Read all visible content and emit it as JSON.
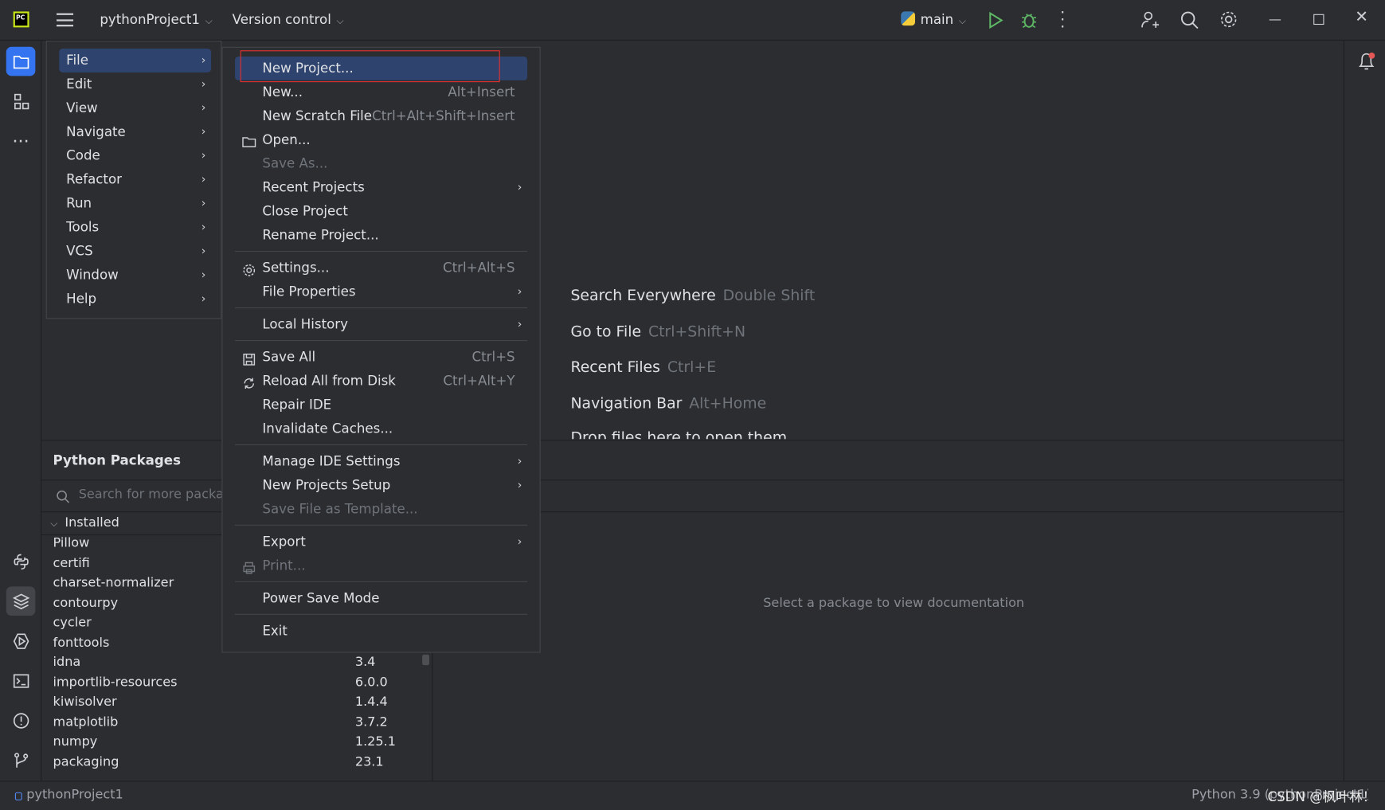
{
  "titlebar": {
    "project": "pythonProject1",
    "vcs": "Version control",
    "run_config": "main"
  },
  "main_menu": {
    "items": [
      {
        "label": "File",
        "selected": true
      },
      {
        "label": "Edit"
      },
      {
        "label": "View"
      },
      {
        "label": "Navigate"
      },
      {
        "label": "Code"
      },
      {
        "label": "Refactor"
      },
      {
        "label": "Run"
      },
      {
        "label": "Tools"
      },
      {
        "label": "VCS"
      },
      {
        "label": "Window"
      },
      {
        "label": "Help"
      }
    ]
  },
  "file_menu": {
    "items": [
      {
        "label": "New Project...",
        "selected": true
      },
      {
        "label": "New...",
        "shortcut": "Alt+Insert"
      },
      {
        "label": "New Scratch File",
        "shortcut": "Ctrl+Alt+Shift+Insert"
      },
      {
        "label": "Open...",
        "icon": "folder-icon"
      },
      {
        "label": "Save As...",
        "disabled": true
      },
      {
        "label": "Recent Projects",
        "submenu": true
      },
      {
        "label": "Close Project"
      },
      {
        "label": "Rename Project..."
      },
      {
        "separator": true
      },
      {
        "label": "Settings...",
        "shortcut": "Ctrl+Alt+S",
        "icon": "gear-icon"
      },
      {
        "label": "File Properties",
        "submenu": true
      },
      {
        "separator": true
      },
      {
        "label": "Local History",
        "submenu": true
      },
      {
        "separator": true
      },
      {
        "label": "Save All",
        "shortcut": "Ctrl+S",
        "icon": "save-icon"
      },
      {
        "label": "Reload All from Disk",
        "shortcut": "Ctrl+Alt+Y",
        "icon": "reload-icon"
      },
      {
        "label": "Repair IDE"
      },
      {
        "label": "Invalidate Caches..."
      },
      {
        "separator": true
      },
      {
        "label": "Manage IDE Settings",
        "submenu": true
      },
      {
        "label": "New Projects Setup",
        "submenu": true
      },
      {
        "label": "Save File as Template...",
        "disabled": true
      },
      {
        "separator": true
      },
      {
        "label": "Export",
        "submenu": true
      },
      {
        "label": "Print...",
        "disabled": true,
        "icon": "printer-icon"
      },
      {
        "separator": true
      },
      {
        "label": "Power Save Mode"
      },
      {
        "separator": true
      },
      {
        "label": "Exit"
      }
    ]
  },
  "editor_hints": [
    {
      "label": "Search Everywhere",
      "shortcut": "Double Shift"
    },
    {
      "label": "Go to File",
      "shortcut": "Ctrl+Shift+N"
    },
    {
      "label": "Recent Files",
      "shortcut": "Ctrl+E"
    },
    {
      "label": "Navigation Bar",
      "shortcut": "Alt+Home"
    },
    {
      "label": "Drop files here to open them",
      "shortcut": ""
    }
  ],
  "packages": {
    "title": "Python Packages",
    "search_placeholder": "Search for more packages",
    "installed_label": "Installed",
    "doc_placeholder": "Select a package to view documentation",
    "rows": [
      {
        "name": "Pillow",
        "version": ""
      },
      {
        "name": "certifi",
        "version": ""
      },
      {
        "name": "charset-normalizer",
        "version": ""
      },
      {
        "name": "contourpy",
        "version": ""
      },
      {
        "name": "cycler",
        "version": ""
      },
      {
        "name": "fonttools",
        "version": ""
      },
      {
        "name": "idna",
        "version": "3.4"
      },
      {
        "name": "importlib-resources",
        "version": "6.0.0"
      },
      {
        "name": "kiwisolver",
        "version": "1.4.4"
      },
      {
        "name": "matplotlib",
        "version": "3.7.2"
      },
      {
        "name": "numpy",
        "version": "1.25.1"
      },
      {
        "name": "packaging",
        "version": "23.1"
      }
    ]
  },
  "statusbar": {
    "project": "pythonProject1",
    "interpreter": "Python 3.9 (pythonProject1)",
    "watermark": "CSDN @枫叶林！"
  },
  "colors": {
    "accent": "#3574f0",
    "selection": "#2e436e",
    "highlight_box": "#e5312f",
    "run": "#5fb865"
  }
}
